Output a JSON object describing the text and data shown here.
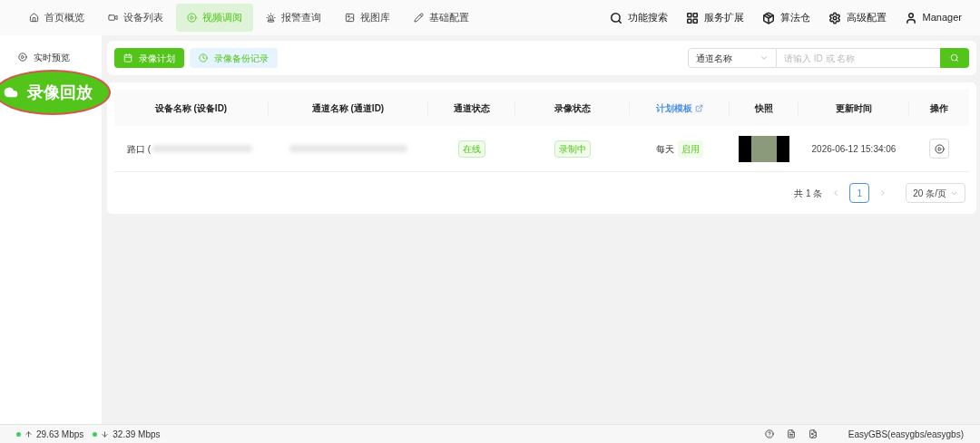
{
  "nav": {
    "items": [
      {
        "label": "首页概览",
        "selected": false
      },
      {
        "label": "设备列表",
        "selected": false
      },
      {
        "label": "视频调阅",
        "selected": true
      },
      {
        "label": "报警查询",
        "selected": false
      },
      {
        "label": "视图库",
        "selected": false
      },
      {
        "label": "基础配置",
        "selected": false
      }
    ],
    "actions": [
      {
        "label": "功能搜索"
      },
      {
        "label": "服务扩展"
      },
      {
        "label": "算法仓"
      },
      {
        "label": "高级配置"
      },
      {
        "label": "Manager"
      }
    ]
  },
  "sidebar": {
    "items": [
      {
        "label": "实时预览",
        "selected": false
      },
      {
        "label": "录像回放",
        "selected": true
      }
    ]
  },
  "toolbar": {
    "buttons": [
      {
        "label": "录像计划",
        "kind": "primary"
      },
      {
        "label": "录像备份记录",
        "kind": "secondary"
      }
    ],
    "filter": {
      "value": "通道名称"
    },
    "search": {
      "placeholder": "请输入 ID 或 名称"
    }
  },
  "table": {
    "columns": [
      {
        "label": "设备名称 (设备ID)",
        "link": false
      },
      {
        "label": "通道名称 (通道ID)",
        "link": false
      },
      {
        "label": "通道状态",
        "link": false
      },
      {
        "label": "录像状态",
        "link": false
      },
      {
        "label": "计划模板",
        "link": true
      },
      {
        "label": "快照",
        "link": false
      },
      {
        "label": "更新时间",
        "link": false
      },
      {
        "label": "操作",
        "link": false
      }
    ],
    "rows": [
      {
        "device": "路口 (",
        "channel_status": "在线",
        "record_status": "录制中",
        "plan": "每天",
        "plan_tag": "启用",
        "updated": "2026-06-12 15:34:06"
      }
    ]
  },
  "pagination": {
    "total": "共 1 条",
    "pages": [
      {
        "label": "1",
        "selected": true
      }
    ],
    "page_size": "20 条/页"
  },
  "status_bar": {
    "up": "29.63 Mbps",
    "down": "32.39 Mbps",
    "account": "EasyGBS(easygbs/easygbs)"
  }
}
